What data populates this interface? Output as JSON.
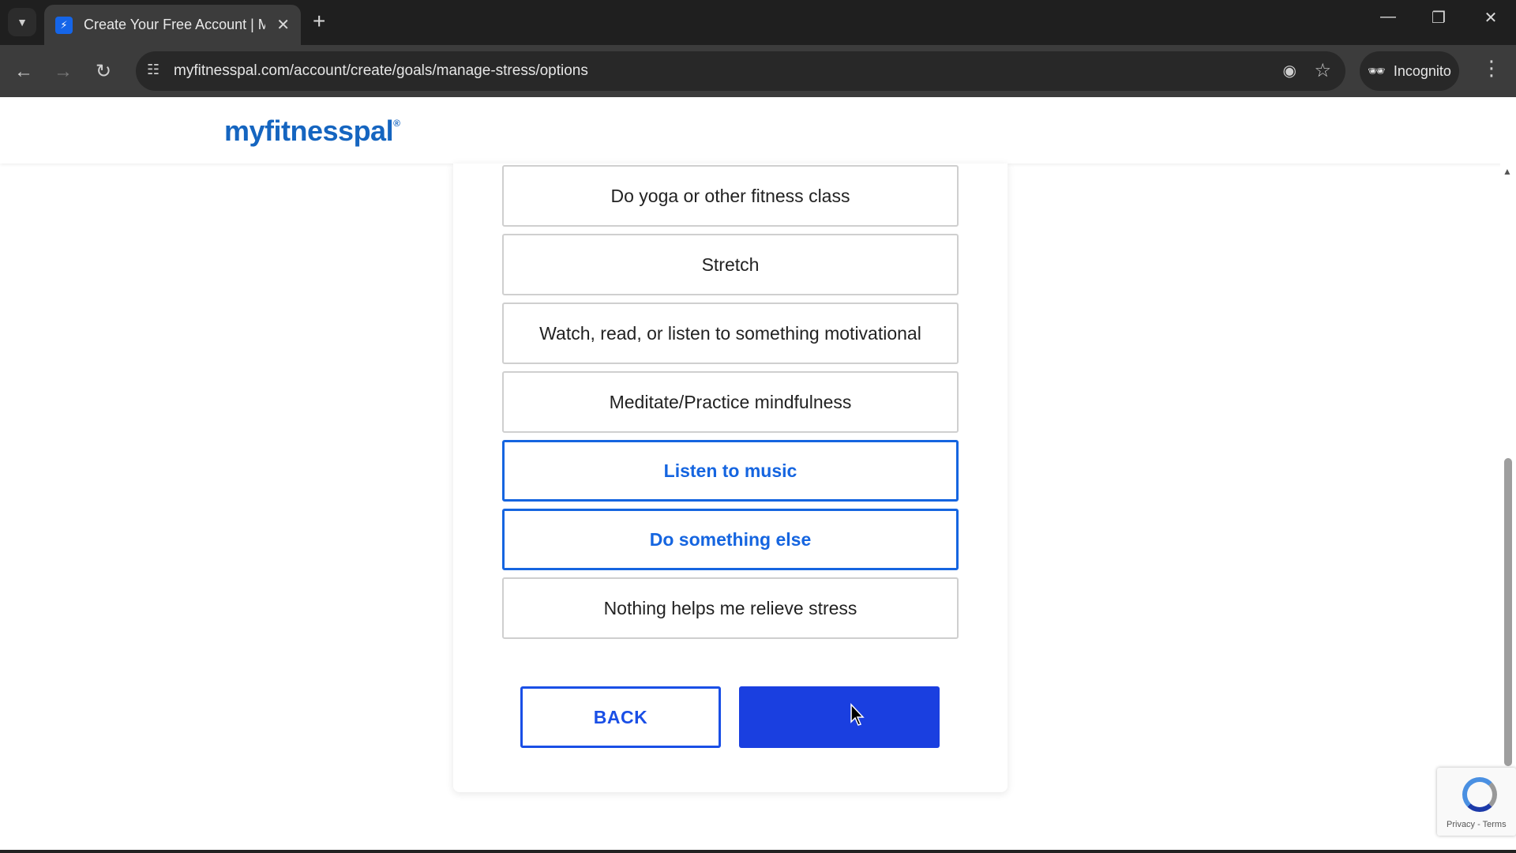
{
  "browser": {
    "tab_title": "Create Your Free Account | MyF",
    "url": "myfitnesspal.com/account/create/goals/manage-stress/options",
    "incognito_label": "Incognito"
  },
  "page": {
    "logo": "myfitnesspal",
    "options": [
      {
        "label": "Do yoga or other fitness class",
        "selected": false
      },
      {
        "label": "Stretch",
        "selected": false
      },
      {
        "label": "Watch, read, or listen to something motivational",
        "selected": false
      },
      {
        "label": "Meditate/Practice mindfulness",
        "selected": false
      },
      {
        "label": "Listen to music",
        "selected": true
      },
      {
        "label": "Do something else",
        "selected": true
      },
      {
        "label": "Nothing helps me relieve stress",
        "selected": false
      }
    ],
    "back_label": "BACK",
    "next_label": ""
  },
  "recaptcha": {
    "links": "Privacy - Terms"
  },
  "colors": {
    "accent": "#1565e0",
    "primary_button": "#1a3fe0"
  }
}
